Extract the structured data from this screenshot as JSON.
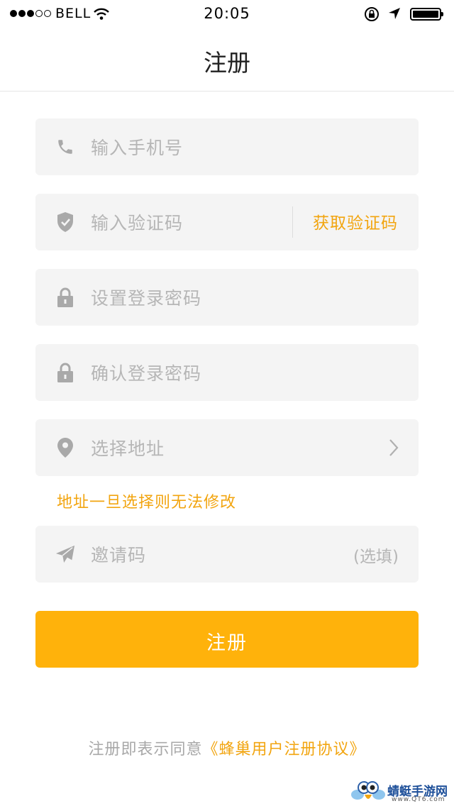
{
  "status_bar": {
    "carrier": "BELL",
    "time": "20:05"
  },
  "nav": {
    "title": "注册"
  },
  "form": {
    "phone_placeholder": "输入手机号",
    "code_placeholder": "输入验证码",
    "get_code_label": "获取验证码",
    "password_placeholder": "设置登录密码",
    "confirm_placeholder": "确认登录密码",
    "address_placeholder": "选择地址",
    "address_note": "地址一旦选择则无法修改",
    "invite_placeholder": "邀请码",
    "invite_optional": "(选填)"
  },
  "submit_label": "注册",
  "agreement": {
    "prefix": "注册即表示同意",
    "link": "《蜂巢用户注册协议》"
  },
  "watermark": {
    "name": "蜻蜓手游网",
    "domain": "www.QT6.com"
  },
  "icons": {
    "phone": "phone-icon",
    "shield": "shield-check-icon",
    "lock": "lock-icon",
    "location": "location-pin-icon",
    "chevron": "chevron-right-icon",
    "invite": "paper-plane-icon"
  },
  "colors": {
    "accent": "#ffb20b",
    "accent_text": "#f2a510",
    "field_bg": "#f4f4f4",
    "placeholder": "#b6b6b6"
  }
}
